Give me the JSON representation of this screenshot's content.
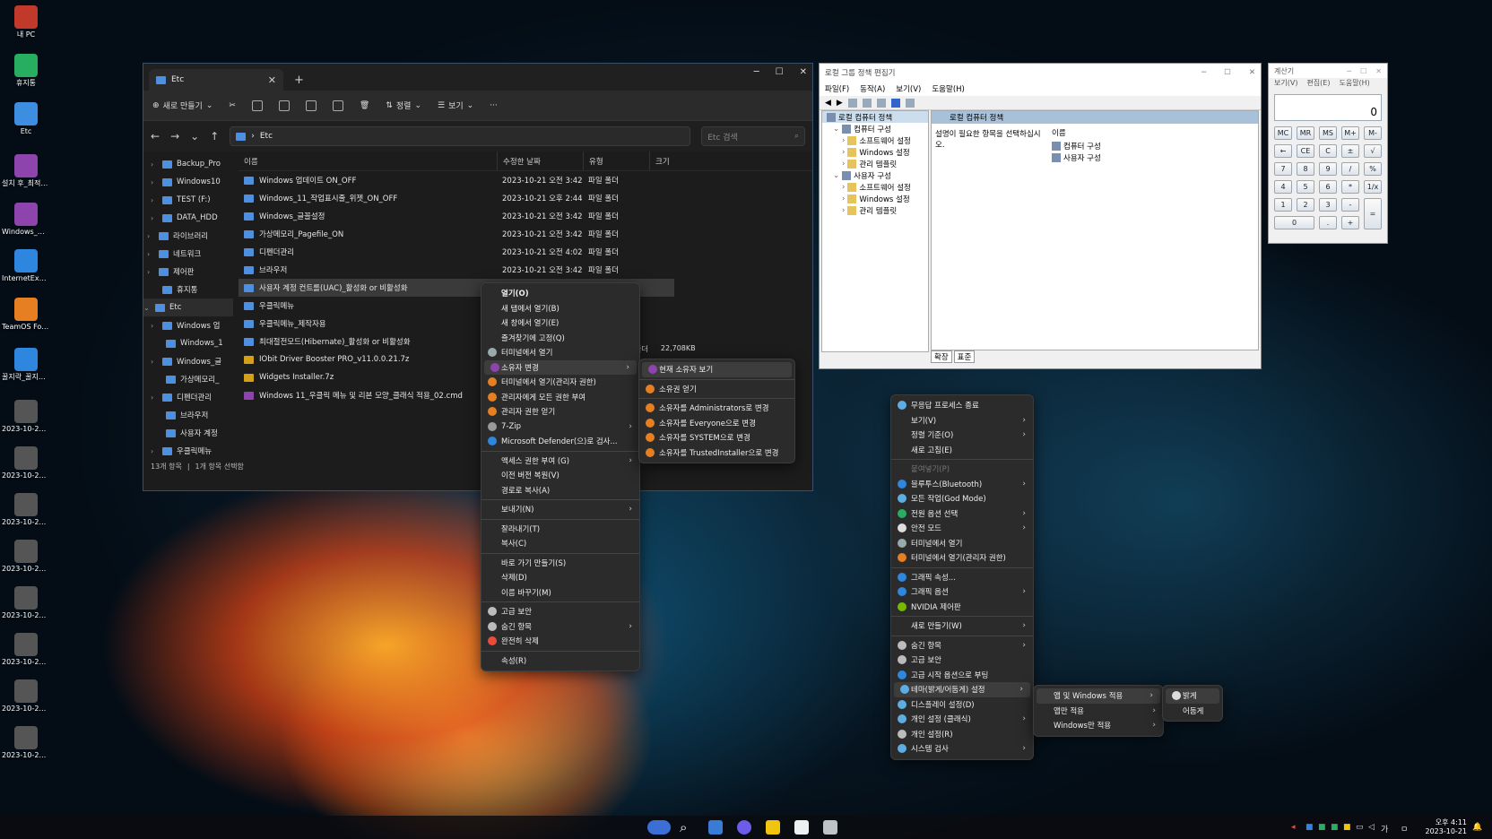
{
  "desktop": {
    "icons": [
      {
        "label": "내 PC",
        "color": "#c0392b"
      },
      {
        "label": "휴지통",
        "color": "#27ae60"
      },
      {
        "label": "Etc",
        "color": "#3d8ee0"
      },
      {
        "label": "설치 후_최적화.cmd",
        "color": "#8e44ad"
      },
      {
        "label": "Windows_정...",
        "color": "#8e44ad"
      },
      {
        "label": "InternetExpl...",
        "color": "#2e86de"
      },
      {
        "label": "TeamOS Forum Ho...",
        "color": "#e67e22"
      },
      {
        "label": "꿀지락_꿀지락...",
        "color": "#2e86de"
      },
      {
        "label": "2023-10-21_...",
        "color": "#555"
      },
      {
        "label": "2023-10-21_...",
        "color": "#555"
      },
      {
        "label": "2023-10-21_...",
        "color": "#555"
      },
      {
        "label": "2023-10-21_...",
        "color": "#555"
      },
      {
        "label": "2023-10-21_...",
        "color": "#555"
      },
      {
        "label": "2023-10-21_...",
        "color": "#555"
      },
      {
        "label": "2023-10-21_...",
        "color": "#555"
      },
      {
        "label": "2023-10-21_...",
        "color": "#555"
      }
    ]
  },
  "explorer": {
    "tab_title": "Etc",
    "tab_close": "✕",
    "new_tab": "+",
    "caption": {
      "min": "─",
      "max": "☐",
      "close": "✕"
    },
    "toolbar": {
      "new": "새로 만들기",
      "sort": "정렬",
      "view": "보기",
      "more": "···"
    },
    "address": "Etc",
    "search_placeholder": "Etc 검색",
    "nav": [
      {
        "label": "Backup_Pro",
        "chev": "›"
      },
      {
        "label": "Windows10",
        "chev": "›"
      },
      {
        "label": "TEST (F:)",
        "chev": "›"
      },
      {
        "label": "DATA_HDD",
        "chev": "›"
      },
      {
        "label": "라이브러리",
        "chev": "›"
      },
      {
        "label": "네트워크",
        "chev": "›"
      },
      {
        "label": "제어판",
        "chev": "›"
      },
      {
        "label": "휴지통",
        "chev": ""
      },
      {
        "label": "Etc",
        "chev": "⌄"
      },
      {
        "label": "Windows 업",
        "chev": "›"
      },
      {
        "label": "Windows_1",
        "chev": ""
      },
      {
        "label": "Windows_글",
        "chev": "›"
      },
      {
        "label": "가상메모리_",
        "chev": ""
      },
      {
        "label": "디펜더관리",
        "chev": "›"
      },
      {
        "label": "브라우저",
        "chev": ""
      },
      {
        "label": "사용자 계정",
        "chev": ""
      },
      {
        "label": "우클릭메뉴",
        "chev": "›"
      },
      {
        "label": "우클릭메뉴",
        "chev": ""
      }
    ],
    "columns": {
      "name": "이름",
      "date": "수정한 날짜",
      "type": "유형",
      "size": "크기"
    },
    "files": [
      {
        "name": "Windows 업데이트 ON_OFF",
        "date": "2023-10-21 오전 3:42",
        "type": "파일 폴더",
        "size": "",
        "kind": "folder"
      },
      {
        "name": "Windows_11_작업표시줄_위젯_ON_OFF",
        "date": "2023-10-21 오후 2:44",
        "type": "파일 폴더",
        "size": "",
        "kind": "folder"
      },
      {
        "name": "Windows_글꼴설정",
        "date": "2023-10-21 오전 3:42",
        "type": "파일 폴더",
        "size": "",
        "kind": "folder"
      },
      {
        "name": "가상메모리_Pagefile_ON",
        "date": "2023-10-21 오전 3:42",
        "type": "파일 폴더",
        "size": "",
        "kind": "folder"
      },
      {
        "name": "디펜더관리",
        "date": "2023-10-21 오전 4:02",
        "type": "파일 폴더",
        "size": "",
        "kind": "folder"
      },
      {
        "name": "브라우저",
        "date": "2023-10-21 오전 3:42",
        "type": "파일 폴더",
        "size": "",
        "kind": "folder"
      },
      {
        "name": "사용자 계정 컨트롤(UAC)_활성화 or 비활성화",
        "date": "",
        "type": "",
        "size": "",
        "kind": "folder",
        "selected": true
      },
      {
        "name": "우클릭메뉴",
        "date": "",
        "type": "",
        "size": "",
        "kind": "folder"
      },
      {
        "name": "우클릭메뉴_제작자용",
        "date": "",
        "type": "",
        "size": "",
        "kind": "folder"
      },
      {
        "name": "최대절전모드(Hibernate)_활성화 or 비활성화",
        "date": "",
        "type": "",
        "size": "",
        "kind": "folder"
      },
      {
        "name": "IObit Driver Booster PRO_v11.0.0.21.7z",
        "date": "",
        "type": "",
        "size": "",
        "kind": "archive"
      },
      {
        "name": "Widgets Installer.7z",
        "date": "",
        "type": "",
        "size": "",
        "kind": "archive"
      },
      {
        "name": "Windows 11_우클릭 메뉴 및 리본 모양_클래식 적용_02.cmd",
        "date": "",
        "type": "",
        "size": "",
        "kind": "cmd"
      }
    ],
    "partial_type": "압축(ZIP) 폴더",
    "partial_size": "22,708KB",
    "status_count": "13개 항목",
    "status_selected": "1개 항목 선택함"
  },
  "context_menu_1": {
    "items": [
      {
        "label": "열기(O)",
        "bold": true
      },
      {
        "label": "새 탭에서 열기(B)"
      },
      {
        "label": "새 창에서 열기(E)"
      },
      {
        "label": "즐겨찾기에 고정(Q)"
      },
      {
        "label": "터미널에서 열기",
        "icon": "#9aa"
      },
      {
        "label": "소유자 변경",
        "icon": "#8e44ad",
        "sub": true,
        "hl": true
      },
      {
        "label": "터미널에서 열기(관리자 권한)",
        "icon": "#e67e22"
      },
      {
        "label": "관리자에게 모든 권한 부여",
        "icon": "#e67e22"
      },
      {
        "label": "관리자 권한 얻기",
        "icon": "#e67e22"
      },
      {
        "label": "7-Zip",
        "icon": "#999",
        "sub": true
      },
      {
        "label": "Microsoft Defender(으)로 검사...",
        "icon": "#2e86de"
      },
      {
        "sep": true
      },
      {
        "label": "액세스 권한 부여 (G)",
        "sub": true
      },
      {
        "label": "이전 버전 복원(V)"
      },
      {
        "label": "경로로 복사(A)"
      },
      {
        "sep": true
      },
      {
        "label": "보내기(N)",
        "sub": true
      },
      {
        "sep": true
      },
      {
        "label": "잘라내기(T)"
      },
      {
        "label": "복사(C)"
      },
      {
        "sep": true
      },
      {
        "label": "바로 가기 만들기(S)"
      },
      {
        "label": "삭제(D)"
      },
      {
        "label": "이름 바꾸기(M)"
      },
      {
        "sep": true
      },
      {
        "label": "고급 보안",
        "icon": "#bbb"
      },
      {
        "label": "숨긴 항목",
        "icon": "#bbb",
        "sub": true
      },
      {
        "label": "완전히 삭제",
        "icon": "#e74c3c"
      },
      {
        "sep": true
      },
      {
        "label": "속성(R)"
      }
    ]
  },
  "owner_submenu": {
    "items": [
      {
        "label": "현재 소유자 보기",
        "icon": "#8e44ad",
        "hl": true
      },
      {
        "sep": true
      },
      {
        "label": "소유권 얻기",
        "icon": "#e67e22"
      },
      {
        "sep": true
      },
      {
        "label": "소유자를 Administrators로 변경",
        "icon": "#e67e22"
      },
      {
        "label": "소유자를 Everyone으로 변경",
        "icon": "#e67e22"
      },
      {
        "label": "소유자를 SYSTEM으로 변경",
        "icon": "#e67e22"
      },
      {
        "label": "소유자를 TrustedInstaller으로 변경",
        "icon": "#e67e22"
      }
    ]
  },
  "desktop_menu": {
    "items": [
      {
        "label": "무응답 프로세스 종료",
        "icon": "#5dade2"
      },
      {
        "label": "보기(V)",
        "sub": true
      },
      {
        "label": "정렬 기준(O)",
        "sub": true
      },
      {
        "label": "새로 고침(E)"
      },
      {
        "sep": true
      },
      {
        "label": "붙여넣기(P)",
        "disabled": true
      },
      {
        "label": "블루투스(Bluetooth)",
        "icon": "#2e86de",
        "sub": true
      },
      {
        "label": "모든 작업(God Mode)",
        "icon": "#5dade2"
      },
      {
        "label": "전원 옵션 선택",
        "icon": "#27ae60",
        "sub": true
      },
      {
        "label": "안전 모드",
        "icon": "#ddd",
        "sub": true
      },
      {
        "label": "터미널에서 열기",
        "icon": "#9aa"
      },
      {
        "label": "터미널에서 열기(관리자 권한)",
        "icon": "#e67e22"
      },
      {
        "sep": true
      },
      {
        "label": "그래픽 속성...",
        "icon": "#2e86de"
      },
      {
        "label": "그래픽 옵션",
        "icon": "#2e86de",
        "sub": true
      },
      {
        "label": "NVIDIA 제어판",
        "icon": "#76b900"
      },
      {
        "sep": true
      },
      {
        "label": "새로 만들기(W)",
        "sub": true
      },
      {
        "sep": true
      },
      {
        "label": "숨긴 항목",
        "icon": "#bbb",
        "sub": true
      },
      {
        "label": "고급 보안",
        "icon": "#bbb"
      },
      {
        "label": "고급 시작 옵션으로 부팅",
        "icon": "#2e86de"
      },
      {
        "label": "테마(밝게/어둡게) 설정",
        "icon": "#5dade2",
        "sub": true,
        "hl": true
      },
      {
        "label": "디스플레이 설정(D)",
        "icon": "#5dade2"
      },
      {
        "label": "개인 설정 (클래식)",
        "icon": "#5dade2",
        "sub": true
      },
      {
        "label": "개인 설정(R)",
        "icon": "#bbb"
      },
      {
        "label": "시스템 검사",
        "icon": "#5dade2",
        "sub": true
      }
    ]
  },
  "theme_submenu": {
    "items": [
      {
        "label": "앱 및 Windows 적용",
        "sub": true,
        "hl": true
      },
      {
        "label": "앱만 적용",
        "sub": true
      },
      {
        "label": "Windows만 적용",
        "sub": true
      }
    ]
  },
  "light_submenu": {
    "items": [
      {
        "label": "밝게",
        "icon": "#ddd",
        "hl": true
      },
      {
        "label": "어둡게"
      }
    ]
  },
  "gpedit": {
    "title": "로컬 그룹 정책 편집기",
    "menu": [
      "파일(F)",
      "동작(A)",
      "보기(V)",
      "도움말(H)"
    ],
    "tree": [
      {
        "label": "로컬 컴퓨터 정책",
        "indent": 0
      },
      {
        "label": "컴퓨터 구성",
        "indent": 1
      },
      {
        "label": "소프트웨어 설정",
        "indent": 2
      },
      {
        "label": "Windows 설정",
        "indent": 2
      },
      {
        "label": "관리 템플릿",
        "indent": 2
      },
      {
        "label": "사용자 구성",
        "indent": 1
      },
      {
        "label": "소프트웨어 설정",
        "indent": 2
      },
      {
        "label": "Windows 설정",
        "indent": 2
      },
      {
        "label": "관리 템플릿",
        "indent": 2
      }
    ],
    "right_header": "로컬 컴퓨터 정책",
    "description": "설명이 필요한 항목을 선택하십시오.",
    "col_name": "이름",
    "entries": [
      "컴퓨터 구성",
      "사용자 구성"
    ],
    "tabs": [
      "확장",
      "표준"
    ]
  },
  "calculator": {
    "title": "계산기",
    "menu": [
      "보기(V)",
      "편집(E)",
      "도움말(H)"
    ],
    "display": "0",
    "keys": [
      [
        "MC",
        "MR",
        "MS",
        "M+",
        "M-"
      ],
      [
        "←",
        "CE",
        "C",
        "±",
        "√"
      ],
      [
        "7",
        "8",
        "9",
        "/",
        "%"
      ],
      [
        "4",
        "5",
        "6",
        "*",
        "1/x"
      ],
      [
        "1",
        "2",
        "3",
        "-",
        "="
      ],
      [
        "0",
        ".",
        "+"
      ]
    ]
  },
  "taskbar": {
    "clock_time": "오후 4:11",
    "clock_date": "2023-10-21",
    "ime": "가",
    "lang": "ㅁ"
  }
}
